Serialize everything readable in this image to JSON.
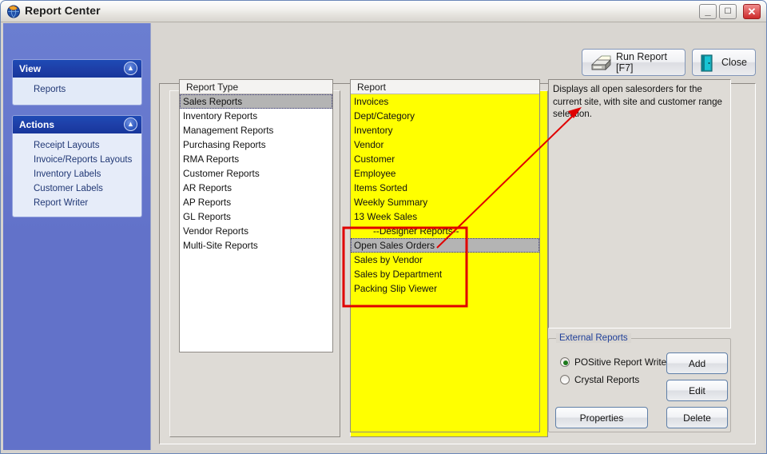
{
  "window": {
    "title": "Report Center",
    "icon": "app-globe-icon",
    "controls": {
      "minimize": "_",
      "maximize": "☐",
      "close": "✕"
    }
  },
  "toolbar": {
    "run_report_label": "Run Report [F7]",
    "run_report_icon": "printer-icon",
    "close_label": "Close",
    "close_icon": "exit-door-icon"
  },
  "sidebar": {
    "panels": [
      {
        "title": "View",
        "collapse_icon": "chevron-up-icon",
        "items": [
          {
            "label": "Reports"
          }
        ]
      },
      {
        "title": "Actions",
        "collapse_icon": "chevron-up-icon",
        "items": [
          {
            "label": "Receipt Layouts"
          },
          {
            "label": "Invoice/Reports Layouts"
          },
          {
            "label": "Inventory Labels"
          },
          {
            "label": "Customer Labels"
          },
          {
            "label": "Report Writer"
          }
        ]
      }
    ]
  },
  "report_type_list": {
    "header": "Report Type",
    "selected_index": 0,
    "items": [
      "Sales Reports",
      "Inventory Reports",
      "Management Reports",
      "Purchasing Reports",
      "RMA Reports",
      "Customer Reports",
      "AR Reports",
      "AP Reports",
      "GL Reports",
      "Vendor Reports",
      "Multi-Site Reports"
    ]
  },
  "report_list": {
    "header": "Report",
    "selected_index": 10,
    "items": [
      "Invoices",
      "Dept/Category",
      "Inventory",
      "Vendor",
      "Customer",
      "Employee",
      "Items Sorted",
      "Weekly Summary",
      "13 Week Sales",
      "--Designer Reports--",
      "Open Sales Orders",
      "Sales by Vendor",
      "Sales by Department",
      "Packing Slip Viewer"
    ]
  },
  "description": {
    "text": "Displays all open salesorders for the current site, with site and customer range selection."
  },
  "external_reports": {
    "legend": "External Reports",
    "legend_color": "#20409a",
    "radios": [
      {
        "label": "POSitive Report Writer",
        "selected": true
      },
      {
        "label": "Crystal Reports",
        "selected": false
      }
    ],
    "buttons": {
      "add": "Add",
      "edit": "Edit",
      "delete": "Delete",
      "properties": "Properties"
    }
  },
  "annotation": {
    "color": "#e00000",
    "rectangle_target": "Designer Reports group in Report list",
    "arrow_from": "Open Sales Orders row",
    "arrow_to": "description text"
  },
  "colors": {
    "list_highlight_yellow": "#ffff00",
    "selection_gray": "#b7b7b7",
    "sidebar_blue": "#6272c9",
    "panel_header_blue": "#1e3fa8"
  }
}
